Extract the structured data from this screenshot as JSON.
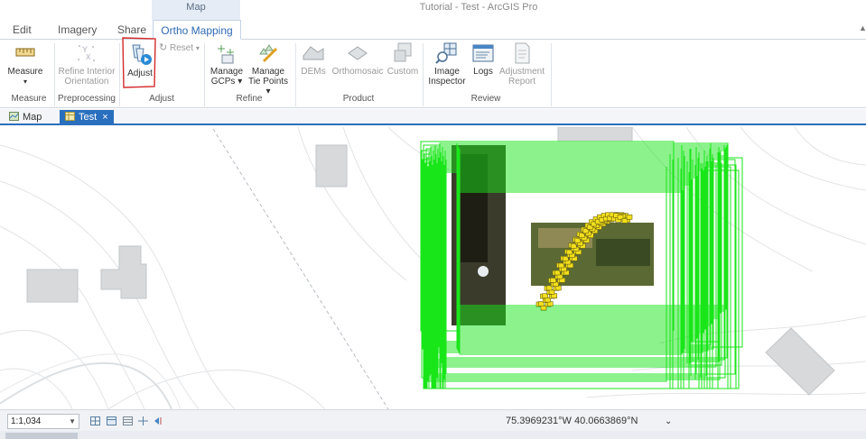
{
  "app": {
    "context_tab_group": "Map",
    "title": "Tutorial - Test - ArcGIS Pro"
  },
  "ribbon_tabs": [
    {
      "label": "Edit"
    },
    {
      "label": "Imagery"
    },
    {
      "label": "Share"
    },
    {
      "label": "Ortho Mapping",
      "active": true
    }
  ],
  "ribbon": {
    "measure": {
      "label": "Measure",
      "group": "Measure"
    },
    "refine_interior": {
      "label_line1": "Refine Interior",
      "label_line2": "Orientation",
      "group": "Preprocessing"
    },
    "adjust": {
      "label": "Adjust",
      "group": "Adjust"
    },
    "reset": {
      "label": "Reset"
    },
    "manage_gcps": {
      "label_line1": "Manage",
      "label_line2": "GCPs"
    },
    "manage_tie_points": {
      "label_line1": "Manage",
      "label_line2": "Tie Points"
    },
    "refine_group": "Refine",
    "dems": {
      "label": "DEMs"
    },
    "orthomosaic": {
      "label": "Orthomosaic"
    },
    "custom": {
      "label": "Custom"
    },
    "product_group": "Product",
    "image_inspector": {
      "label_line1": "Image",
      "label_line2": "Inspector"
    },
    "logs": {
      "label": "Logs"
    },
    "adjustment_report": {
      "label_line1": "Adjustment",
      "label_line2": "Report"
    },
    "review_group": "Review"
  },
  "views": [
    {
      "label": "Map",
      "active": false
    },
    {
      "label": "Test",
      "active": true,
      "close": "×"
    }
  ],
  "statusbar": {
    "scale": "1:1,034",
    "coordinates": "75.3969231°W 40.0663869°N"
  },
  "colors": {
    "accent": "#2a6fbe",
    "footprints": "#19e619",
    "tie_points": "#f3e01c",
    "annotation": "#d42a2a"
  },
  "icons": [
    "measure-icon",
    "refine-interior-icon",
    "adjust-icon",
    "reset-icon",
    "manage-gcps-icon",
    "manage-tie-points-icon",
    "dems-icon",
    "orthomosaic-icon",
    "custom-icon",
    "image-inspector-icon",
    "logs-icon",
    "adjustment-report-icon",
    "map-icon",
    "table-icon"
  ]
}
